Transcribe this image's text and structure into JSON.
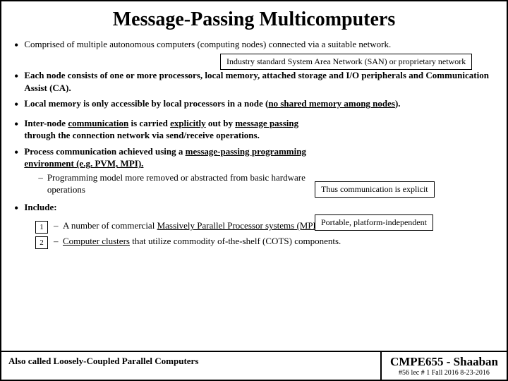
{
  "title": "Message-Passing Multicomputers",
  "bullets": [
    {
      "id": "b1",
      "text_parts": [
        {
          "text": "Comprised of multiple autonomous computers (computing nodes) connected via a suitable network.",
          "style": "normal"
        }
      ]
    },
    {
      "id": "b2",
      "text_parts": [
        {
          "text": "Each node consists of one or more processors, local memory, attached storage and I/O peripherals and Communication Assist (CA).",
          "style": "bold"
        }
      ]
    },
    {
      "id": "b3",
      "text_parts": [
        {
          "text": "Local memory is only accessible by local processors in a node (",
          "style": "bold"
        },
        {
          "text": "no shared memory among nodes",
          "style": "bold-underline"
        },
        {
          "text": ").",
          "style": "bold"
        }
      ]
    },
    {
      "id": "b4",
      "text_parts": [
        {
          "text": "Inter-node ",
          "style": "bold"
        },
        {
          "text": "communication",
          "style": "bold-underline"
        },
        {
          "text": " is carried ",
          "style": "bold"
        },
        {
          "text": "explicitly",
          "style": "bold-underline"
        },
        {
          "text": " out by ",
          "style": "bold"
        },
        {
          "text": "message passing",
          "style": "bold-underline"
        },
        {
          "text": " through the connection network via send/receive operations.",
          "style": "bold"
        }
      ]
    },
    {
      "id": "b5",
      "text_parts": [
        {
          "text": "Process communication achieved using a ",
          "style": "bold"
        },
        {
          "text": "message-passing programming environment (e.g. PVM, MPI).",
          "style": "bold-underline"
        }
      ],
      "sub_bullets": [
        {
          "text": "Programming model more removed or abstracted from basic hardware operations"
        }
      ]
    },
    {
      "id": "b6",
      "text_parts": [
        {
          "text": "Include:",
          "style": "bold"
        }
      ]
    }
  ],
  "numbered_items": [
    {
      "number": "1",
      "text_parts": [
        {
          "text": "A number of commercial "
        },
        {
          "text": "Massively Parallel Processor systems (MPPs).",
          "style": "underline"
        }
      ]
    },
    {
      "number": "2",
      "text_parts": [
        {
          "text": ""
        },
        {
          "text": "Computer clusters",
          "style": "underline"
        },
        {
          "text": " that utilize commodity of-the-shelf (COTS) components."
        }
      ]
    }
  ],
  "tooltips": {
    "san": "Industry standard System Area Network (SAN) or proprietary network",
    "explicit": "Thus communication is explicit",
    "portable": "Portable, platform-independent"
  },
  "footer": {
    "left": "Also called Loosely-Coupled Parallel Computers",
    "course": "CMPE655 - Shaaban",
    "meta": "#56  lec # 1  Fall 2016  8-23-2016"
  }
}
